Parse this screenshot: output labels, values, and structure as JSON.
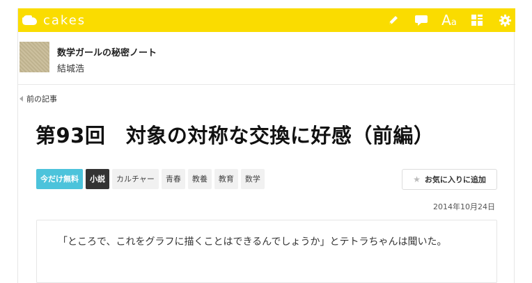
{
  "header": {
    "logo_text": "cakes",
    "brand_color": "#fadc00",
    "tools": [
      {
        "icon": "pencil-icon",
        "label": "write"
      },
      {
        "icon": "comment-icon",
        "label": "comments"
      },
      {
        "icon": "font-size-icon",
        "glyph_main": "A",
        "glyph_small": "a"
      },
      {
        "icon": "grid-icon",
        "label": "layout"
      },
      {
        "icon": "gear-icon",
        "label": "settings"
      }
    ]
  },
  "series": {
    "title": "数学ガールの秘密ノート",
    "author": "結城浩"
  },
  "nav": {
    "prev_label": "前の記事"
  },
  "article": {
    "title": "第93回　対象の対称な交換に好感（前編）",
    "date": "2014年10月24日",
    "lead": "「ところで、これをグラフに描くことはできるんでしょうか」とテトラちゃんは聞いた。"
  },
  "tags": {
    "free": "今だけ無料",
    "genre": "小説",
    "items": [
      "カルチャー",
      "青春",
      "教養",
      "教育",
      "数学"
    ]
  },
  "favorite": {
    "label": "お気に入りに追加",
    "icon": "star-icon"
  }
}
